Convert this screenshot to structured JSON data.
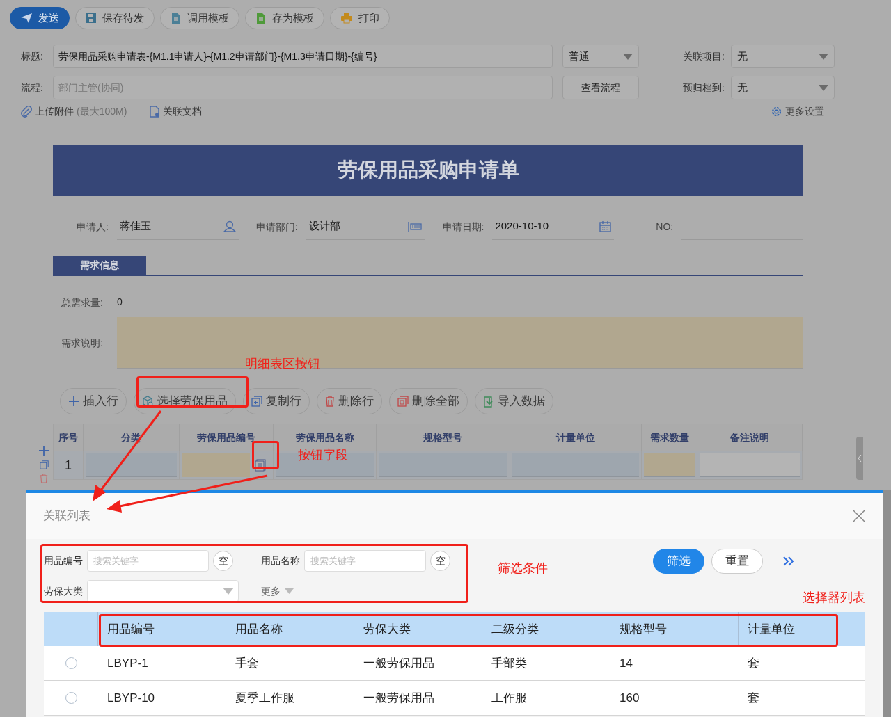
{
  "toolbar": [
    {
      "label": "发送",
      "kind": "send"
    },
    {
      "label": "保存待发",
      "kind": "save"
    },
    {
      "label": "调用模板",
      "kind": "template"
    },
    {
      "label": "存为模板",
      "kind": "store"
    },
    {
      "label": "打印",
      "kind": "print"
    }
  ],
  "title_field": {
    "label": "标题:",
    "value": "劳保用品采购申请表-{M1.1申请人}-{M1.2申请部门}-{M1.3申请日期}-{编号}"
  },
  "priority_select": {
    "value": "普通"
  },
  "related_project": {
    "label": "关联项目:",
    "value": "无"
  },
  "flow_field": {
    "label": "流程:",
    "placeholder": "部门主管(协同)"
  },
  "view_flow_button": "查看流程",
  "archive_select": {
    "label": "预归档到:",
    "value": "无"
  },
  "attachment_link": {
    "label": "上传附件",
    "hint": "(最大100M)"
  },
  "related_doc_link": "关联文档",
  "more_settings_link": "更多设置",
  "form": {
    "title": "劳保用品采购申请单",
    "fields": [
      {
        "label": "申请人:",
        "value": "蒋佳玉",
        "kind": "person"
      },
      {
        "label": "申请部门:",
        "value": "设计部",
        "kind": "dept"
      },
      {
        "label": "申请日期:",
        "value": "2020-10-10",
        "kind": "date"
      },
      {
        "label": "NO:",
        "kind": "plain"
      }
    ],
    "section_tab": "需求信息",
    "total_field": {
      "label": "总需求量:",
      "value": "0"
    },
    "note_field": {
      "label": "需求说明:"
    },
    "detail_buttons": [
      {
        "label": "插入行",
        "kind": "insert"
      },
      {
        "label": "选择劳保用品",
        "kind": "select"
      },
      {
        "label": "复制行",
        "kind": "copy"
      },
      {
        "label": "删除行",
        "kind": "delete"
      },
      {
        "label": "删除全部",
        "kind": "clear"
      },
      {
        "label": "导入数据",
        "kind": "import"
      }
    ],
    "detail_table": {
      "columns": [
        "序号",
        "分类",
        "劳保用品编号",
        "劳保用品名称",
        "规格型号",
        "计量单位",
        "需求数量",
        "备注说明"
      ],
      "rows": [
        {
          "index": "1"
        }
      ]
    }
  },
  "modal": {
    "title": "关联列表",
    "filters": [
      {
        "label": "用品编号",
        "kind": "text",
        "placeholder": "搜索关键字",
        "clear": "空"
      },
      {
        "label": "用品名称",
        "kind": "text",
        "placeholder": "搜索关键字",
        "clear": "空"
      },
      {
        "label": "劳保大类",
        "kind": "select"
      }
    ],
    "more": "更多",
    "buttons": [
      {
        "label": "筛选",
        "kind": "primary"
      },
      {
        "label": "重置",
        "kind": "default"
      }
    ],
    "columns": [
      "用品编号",
      "用品名称",
      "劳保大类",
      "二级分类",
      "规格型号",
      "计量单位"
    ],
    "rows": [
      {
        "selected": false,
        "cells": [
          "LBYP-1",
          "手套",
          "一般劳保用品",
          "手部类",
          "14",
          "套"
        ]
      },
      {
        "selected": false,
        "cells": [
          "LBYP-10",
          "夏季工作服",
          "一般劳保用品",
          "工作服",
          "160",
          "套"
        ]
      }
    ]
  },
  "annotations": [
    "明细表区按钮",
    "按钮字段",
    "筛选条件",
    "选择器列表"
  ]
}
